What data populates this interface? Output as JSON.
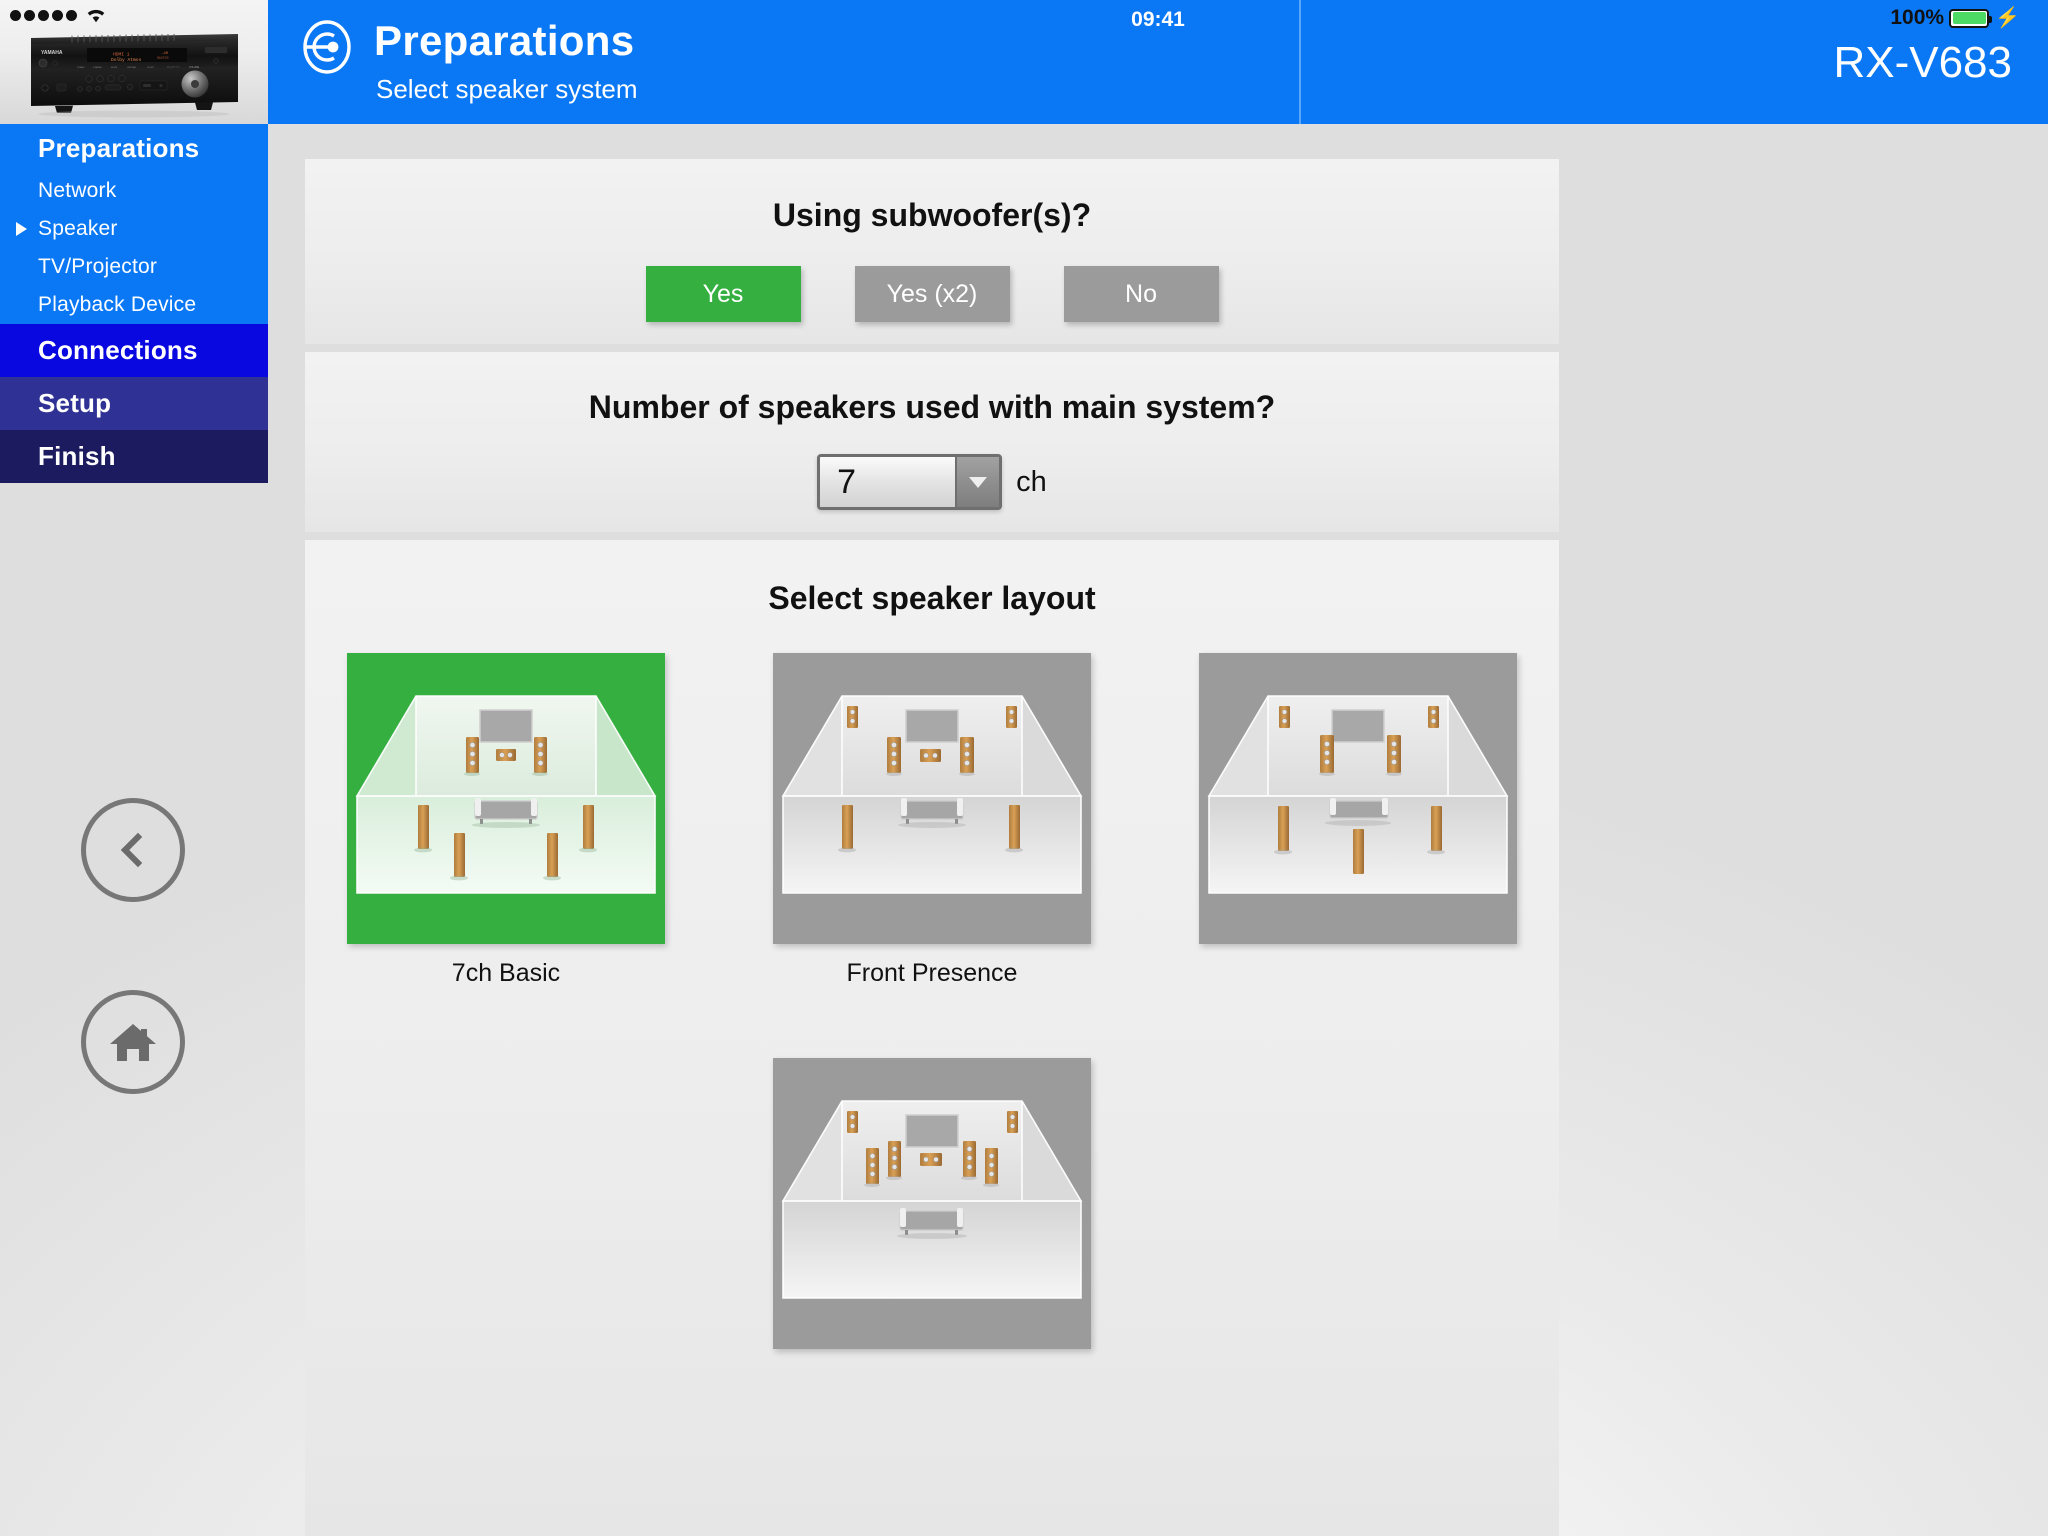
{
  "status_bar": {
    "signal_dots": 5,
    "wifi_icon": "wifi-icon",
    "time": "09:41",
    "battery_percent": "100%",
    "charging_icon": "lightning-bolt-icon"
  },
  "header": {
    "icon": "preparations-circle-icon",
    "title": "Preparations",
    "subtitle": "Select speaker system",
    "model": "RX-V683"
  },
  "sidebar": {
    "device_image": "yamaha-av-receiver-image",
    "items": [
      {
        "label": "Preparations",
        "level": "main",
        "state": "active"
      },
      {
        "label": "Network",
        "level": "sub",
        "state": "default"
      },
      {
        "label": "Speaker",
        "level": "sub",
        "state": "current"
      },
      {
        "label": "TV/Projector",
        "level": "sub",
        "state": "default"
      },
      {
        "label": "Playback Device",
        "level": "sub",
        "state": "default"
      },
      {
        "label": "Connections",
        "level": "main",
        "state": "default"
      },
      {
        "label": "Setup",
        "level": "main",
        "state": "default"
      },
      {
        "label": "Finish",
        "level": "main",
        "state": "default"
      }
    ]
  },
  "nav_buttons": {
    "back": "chevron-left-icon",
    "forward": "chevron-right-icon",
    "home": "home-icon",
    "manual": "manual-book-icon"
  },
  "main": {
    "subwoofer": {
      "question": "Using subwoofer(s)?",
      "options": [
        {
          "label": "Yes",
          "selected": true
        },
        {
          "label": "Yes (x2)",
          "selected": false
        },
        {
          "label": "No",
          "selected": false
        }
      ]
    },
    "channels": {
      "question": "Number of speakers used with main system?",
      "value": "7",
      "unit": "ch"
    },
    "layout": {
      "question": "Select speaker layout",
      "options": [
        {
          "label": "7ch Basic",
          "selected": true,
          "variant": "basic7"
        },
        {
          "label": "Front Presence",
          "selected": false,
          "variant": "front_presence"
        },
        {
          "label": "",
          "selected": false,
          "variant": "presence_no_center"
        },
        {
          "label": "",
          "selected": false,
          "variant": "multi_front"
        }
      ]
    }
  },
  "colors": {
    "brand_blue": "#0a78f5",
    "connections_blue": "#0a08e0",
    "setup_indigo": "#2f3194",
    "finish_navy": "#1c1b60",
    "selected_green": "#35b040",
    "unselected_gray": "#9b9b9b",
    "battery_green": "#4cd964"
  }
}
